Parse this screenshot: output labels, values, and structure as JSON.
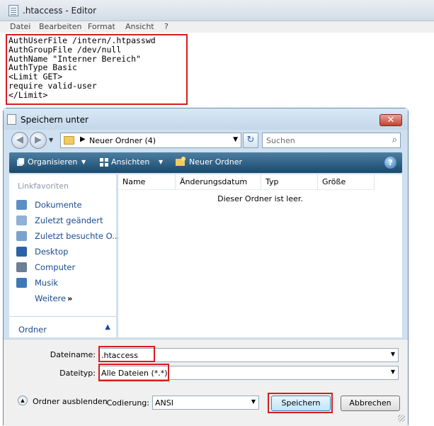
{
  "editor": {
    "title": ".htaccess - Editor",
    "menu": [
      "Datei",
      "Bearbeiten",
      "Format",
      "Ansicht",
      "?"
    ],
    "lines": [
      "AuthUserFile /intern/.htpasswd",
      "AuthGroupFile /dev/null",
      "AuthName \"Interner Bereich\"",
      "AuthType Basic",
      "<Limit GET>",
      "require valid-user",
      "</Limit>"
    ]
  },
  "dialog": {
    "title": "Speichern unter",
    "close_label": "✕",
    "address": "Neuer Ordner (4)",
    "search_placeholder": "Suchen",
    "toolbar": {
      "organize": "Organisieren",
      "views": "Ansichten",
      "new_folder": "Neuer Ordner",
      "help": "?"
    },
    "favorites_header": "Linkfavoriten",
    "favorites": [
      {
        "label": "Dokumente",
        "icon": "documents-icon"
      },
      {
        "label": "Zuletzt geändert",
        "icon": "recent-changed-icon"
      },
      {
        "label": "Zuletzt besuchte O...",
        "icon": "recent-places-icon"
      },
      {
        "label": "Desktop",
        "icon": "desktop-icon"
      },
      {
        "label": "Computer",
        "icon": "computer-icon"
      },
      {
        "label": "Musik",
        "icon": "music-icon"
      },
      {
        "label": "Weitere",
        "icon": ""
      }
    ],
    "more_chevron": "»",
    "folders_label": "Ordner",
    "columns": [
      "Name",
      "Änderungsdatum",
      "Typ",
      "Größe"
    ],
    "empty_message": "Dieser Ordner ist leer.",
    "filename_label": "Dateiname:",
    "filename_value": ".htaccess",
    "filetype_label": "Dateityp:",
    "filetype_value": "Alle Dateien  (*.*)",
    "hide_folders": "Ordner ausblenden",
    "encoding_label": "Codierung:",
    "encoding_value": "ANSI",
    "save_button": "Speichern",
    "cancel_button": "Abbrechen"
  },
  "colors": {
    "highlight": "#d91c1c",
    "toolbar": "#2a5b80",
    "link": "#1a4c91"
  }
}
